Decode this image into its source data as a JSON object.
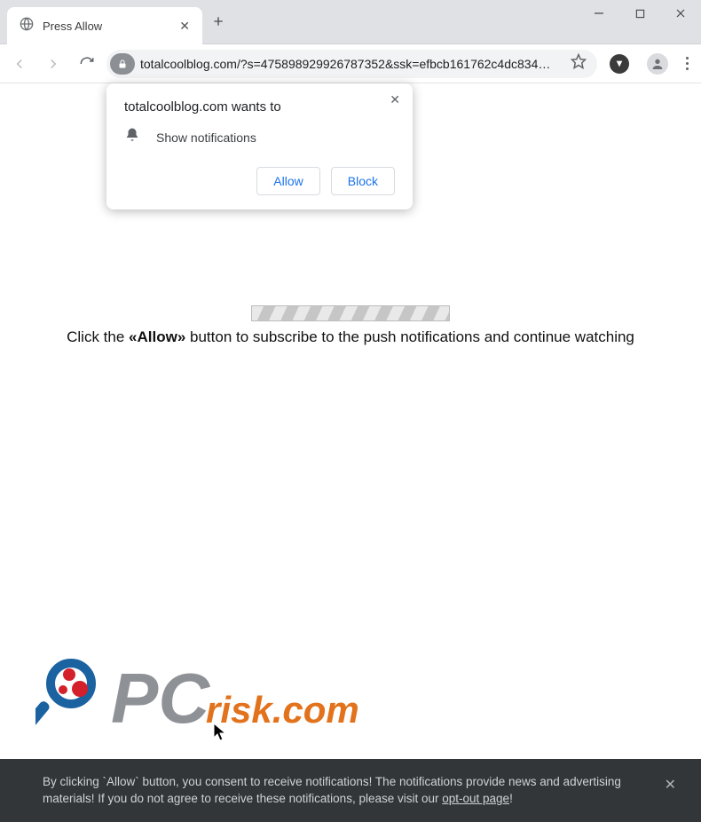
{
  "window": {
    "tab_title": "Press Allow",
    "url": "totalcoolblog.com/?s=475898929926787352&ssk=efbcb161762c4dc834…"
  },
  "permission": {
    "title": "totalcoolblog.com wants to",
    "row_label": "Show notifications",
    "allow_label": "Allow",
    "block_label": "Block"
  },
  "page": {
    "msg_pre": "Click the ",
    "msg_bold": "«Allow»",
    "msg_post": " button to subscribe to the push notifications and continue watching"
  },
  "logo": {
    "text_pc": "PC",
    "text_risk": "risk.com"
  },
  "consent": {
    "text_1": "By clicking `Allow` button, you consent to receive notifications! The notifications provide news and advertising materials! If you do not agree to receive these notifications, please visit our ",
    "link": "opt-out page",
    "text_2": "!"
  }
}
